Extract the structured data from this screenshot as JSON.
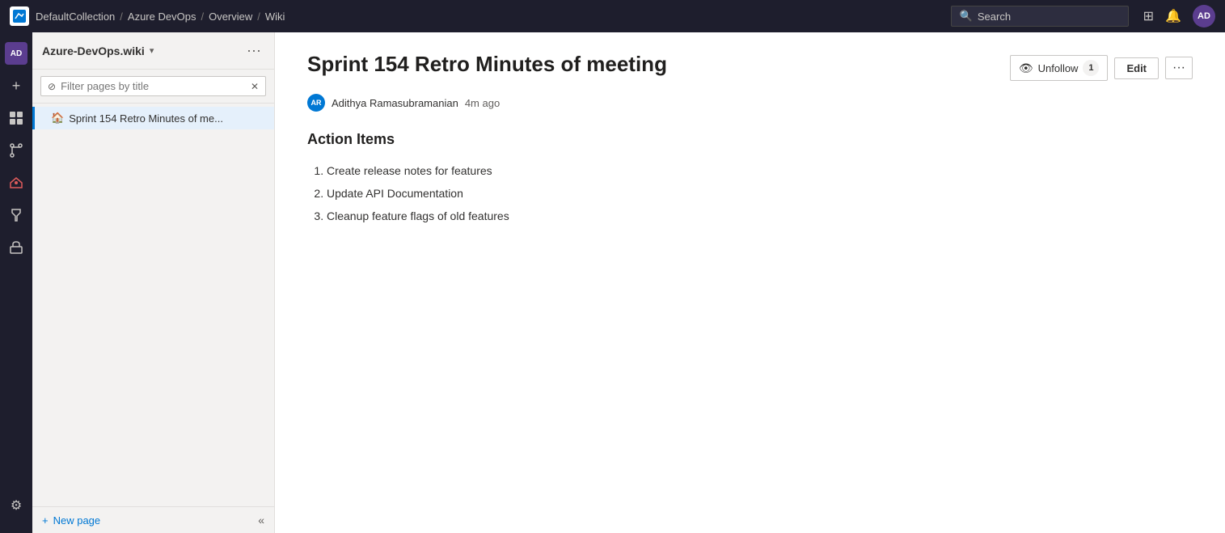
{
  "topNav": {
    "logo": "AD",
    "breadcrumbs": [
      {
        "label": "DefaultCollection"
      },
      {
        "label": "Azure DevOps"
      },
      {
        "label": "Overview"
      },
      {
        "label": "Wiki"
      }
    ],
    "search": {
      "placeholder": "Search",
      "icon": "🔍"
    },
    "icons": {
      "grid": "☰",
      "basket": "🛒"
    },
    "avatarText": "AD"
  },
  "iconRail": {
    "items": [
      {
        "id": "ad-logo",
        "text": "AD",
        "isLogo": true
      },
      {
        "id": "add",
        "icon": "+"
      },
      {
        "id": "boards",
        "icon": "▦"
      },
      {
        "id": "repos",
        "icon": "⎇"
      },
      {
        "id": "pipelines",
        "icon": "▶"
      },
      {
        "id": "testplans",
        "icon": "🧪"
      },
      {
        "id": "artifacts",
        "icon": "📦"
      }
    ],
    "bottom": {
      "settings": "⚙"
    }
  },
  "sidebar": {
    "wikiTitle": "Azure-DevOps.wiki",
    "chevronIcon": "▾",
    "moreIcon": "···",
    "filter": {
      "placeholder": "Filter pages by title",
      "filterIcon": "⊘",
      "clearIcon": "✕"
    },
    "pages": [
      {
        "id": "sprint-page",
        "icon": "🏠",
        "label": "Sprint 154 Retro Minutes of me..."
      }
    ],
    "footer": {
      "newPage": "New page",
      "addIcon": "+",
      "collapseIcon": "«"
    }
  },
  "article": {
    "title": "Sprint 154 Retro Minutes of meeting",
    "authorAvatarText": "AR",
    "authorName": "Adithya Ramasubramanian",
    "timeAgo": "4m ago",
    "actions": {
      "unfollowLabel": "Unfollow",
      "followIcon": "👁",
      "followCount": "1",
      "editLabel": "Edit",
      "moreIcon": "···"
    },
    "content": {
      "sectionTitle": "Action Items",
      "items": [
        {
          "text": "Create release notes for features"
        },
        {
          "text": "Update API Documentation"
        },
        {
          "text": "Cleanup feature flags of old features"
        }
      ]
    }
  }
}
